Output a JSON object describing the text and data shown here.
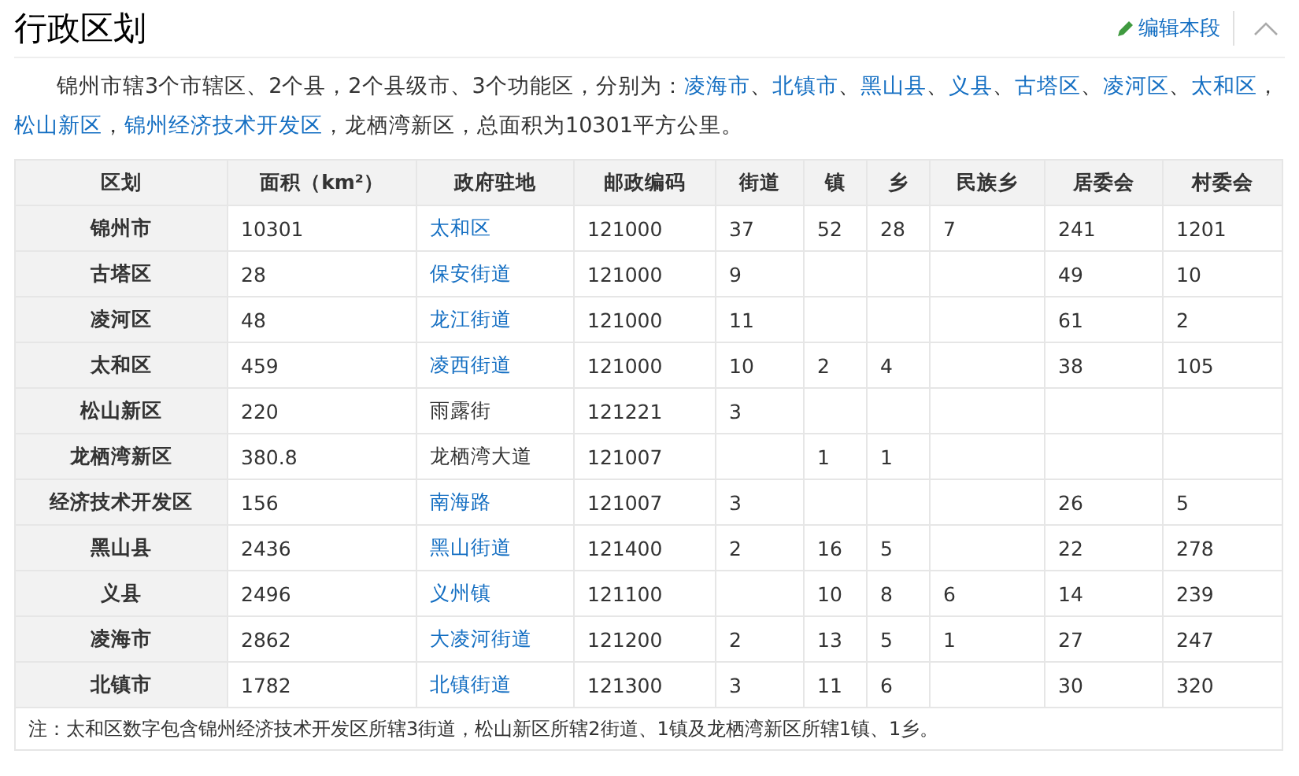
{
  "section": {
    "title": "行政区划",
    "edit_label": "编辑本段"
  },
  "paragraph": [
    {
      "text": "锦州市辖3个市辖区、2个县，2个县级市、3个功能区，分别为：",
      "link": false
    },
    {
      "text": "凌海市",
      "link": true
    },
    {
      "text": "、",
      "link": false
    },
    {
      "text": "北镇市",
      "link": true
    },
    {
      "text": "、",
      "link": false
    },
    {
      "text": "黑山县",
      "link": true
    },
    {
      "text": "、",
      "link": false
    },
    {
      "text": "义县",
      "link": true
    },
    {
      "text": "、",
      "link": false
    },
    {
      "text": "古塔区",
      "link": true
    },
    {
      "text": "、",
      "link": false
    },
    {
      "text": "凌河区",
      "link": true
    },
    {
      "text": "、",
      "link": false
    },
    {
      "text": "太和区",
      "link": true
    },
    {
      "text": "，",
      "link": false
    },
    {
      "text": "松山新区",
      "link": true
    },
    {
      "text": "，",
      "link": false
    },
    {
      "text": "锦州经济技术开发区",
      "link": true
    },
    {
      "text": "，龙栖湾新区，总面积为10301平方公里。",
      "link": false
    }
  ],
  "table": {
    "columns": [
      "区划",
      "面积（km²）",
      "政府驻地",
      "邮政编码",
      "街道",
      "镇",
      "乡",
      "民族乡",
      "居委会",
      "村委会"
    ],
    "rows": [
      {
        "cells": [
          "锦州市",
          "10301",
          "太和区",
          "121000",
          "37",
          "52",
          "28",
          "7",
          "241",
          "1201"
        ],
        "seat_link": true
      },
      {
        "cells": [
          "古塔区",
          "28",
          "保安街道",
          "121000",
          "9",
          null,
          null,
          null,
          "49",
          "10"
        ],
        "seat_link": true
      },
      {
        "cells": [
          "凌河区",
          "48",
          "龙江街道",
          "121000",
          "11",
          null,
          null,
          null,
          "61",
          "2"
        ],
        "seat_link": true
      },
      {
        "cells": [
          "太和区",
          "459",
          "凌西街道",
          "121000",
          "10",
          "2",
          "4",
          null,
          "38",
          "105"
        ],
        "seat_link": true
      },
      {
        "cells": [
          "松山新区",
          "220",
          "雨露街",
          "121221",
          "3",
          null,
          null,
          null,
          null,
          null
        ],
        "seat_link": false
      },
      {
        "cells": [
          "龙栖湾新区",
          "380.8",
          "龙栖湾大道",
          "121007",
          null,
          "1",
          "1",
          null,
          null,
          null
        ],
        "seat_link": false
      },
      {
        "cells": [
          "经济技术开发区",
          "156",
          "南海路",
          "121007",
          "3",
          null,
          null,
          null,
          "26",
          "5"
        ],
        "seat_link": true
      },
      {
        "cells": [
          "黑山县",
          "2436",
          "黑山街道",
          "121400",
          "2",
          "16",
          "5",
          null,
          "22",
          "278"
        ],
        "seat_link": true
      },
      {
        "cells": [
          "义县",
          "2496",
          "义州镇",
          "121100",
          null,
          "10",
          "8",
          "6",
          "14",
          "239"
        ],
        "seat_link": true
      },
      {
        "cells": [
          "凌海市",
          "2862",
          "大凌河街道",
          "121200",
          "2",
          "13",
          "5",
          "1",
          "27",
          "247"
        ],
        "seat_link": true
      },
      {
        "cells": [
          "北镇市",
          "1782",
          "北镇街道",
          "121300",
          "3",
          "11",
          "6",
          null,
          "30",
          "320"
        ],
        "seat_link": true
      }
    ],
    "note": "注：太和区数字包含锦州经济技术开发区所辖3街道，松山新区所辖2街道、1镇及龙栖湾新区所辖1镇、1乡。"
  }
}
